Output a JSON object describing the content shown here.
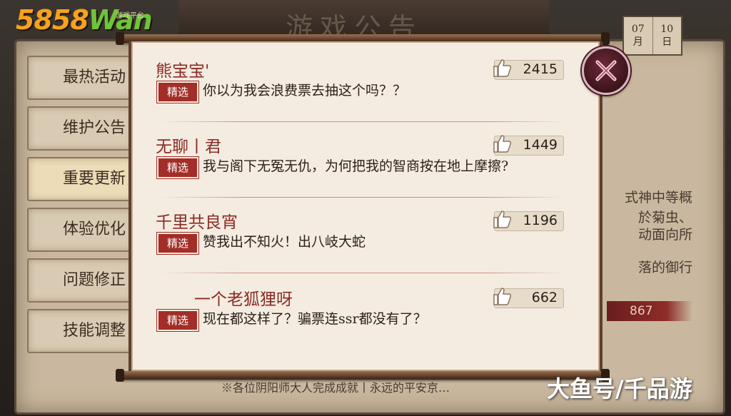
{
  "background": {
    "title": "游戏公告",
    "date": {
      "month": "07",
      "month_unit": "月",
      "day": "10",
      "day_unit": "日"
    },
    "menu": [
      "最热活动",
      "维护公告",
      "重要更新",
      "体验优化",
      "问题修正",
      "技能调整"
    ],
    "right_text": [
      "式神中等概",
      "於菊虫、",
      "动面向所",
      "落的御行"
    ],
    "badge": "867",
    "bottom_text": "※各位阴阳师大人完成成就丨永远的平安京…"
  },
  "logo": {
    "num": "5858",
    "wan": "Wan",
    "sub": "游戏平台"
  },
  "comments": [
    {
      "name": "熊宝宝'",
      "tag": "精选",
      "text": "你以为我会浪费票去抽这个吗？？",
      "likes": "2415"
    },
    {
      "name": "无聊丨君",
      "tag": "精选",
      "text": "我与阁下无冤无仇，为何把我的智商按在地上摩擦?",
      "likes": "1449"
    },
    {
      "name": "千里共良宵",
      "tag": "精选",
      "text": "赞我出不知火！出八岐大蛇",
      "likes": "1196"
    },
    {
      "name": "一个老狐狸呀",
      "tag": "精选",
      "text": "现在都这样了？骗票连ssr都没有了？",
      "likes": "662"
    }
  ],
  "watermark": "大鱼号/千品游",
  "colors": {
    "accent_red": "#a32d27",
    "paper": "#f4ece0",
    "logo_orange": "#f6a21a",
    "logo_green": "#6ec43a"
  },
  "icons": {
    "like": "thumbs-up-icon",
    "close": "close-x-icon"
  }
}
